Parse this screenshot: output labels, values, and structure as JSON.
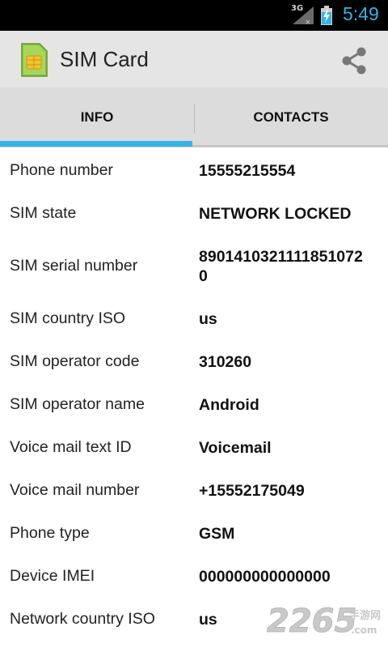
{
  "status_bar": {
    "network_type": "3G",
    "time": "5:49",
    "clock_color": "#33b5e5"
  },
  "action_bar": {
    "title": "SIM Card",
    "share_icon": "share-icon",
    "app_icon": "sim-card-icon"
  },
  "tabs": [
    {
      "label": "INFO",
      "selected": true
    },
    {
      "label": "CONTACTS",
      "selected": false
    }
  ],
  "accent_color": "#33b5e5",
  "rows": [
    {
      "label": "Phone number",
      "value": "15555215554"
    },
    {
      "label": "SIM state",
      "value": "NETWORK LOCKED"
    },
    {
      "label": "SIM serial number",
      "value": "89014103211118510720"
    },
    {
      "label": "SIM country ISO",
      "value": "us"
    },
    {
      "label": "SIM operator code",
      "value": "310260"
    },
    {
      "label": "SIM operator name",
      "value": "Android"
    },
    {
      "label": "Voice mail text ID",
      "value": "Voicemail"
    },
    {
      "label": "Voice mail number",
      "value": "+15552175049"
    },
    {
      "label": "Phone type",
      "value": "GSM"
    },
    {
      "label": "Device IMEI",
      "value": "000000000000000"
    },
    {
      "label": "Network country ISO",
      "value": "us"
    }
  ],
  "watermark": {
    "number": "2265",
    "suffix": ".com",
    "cn": "手游网"
  }
}
